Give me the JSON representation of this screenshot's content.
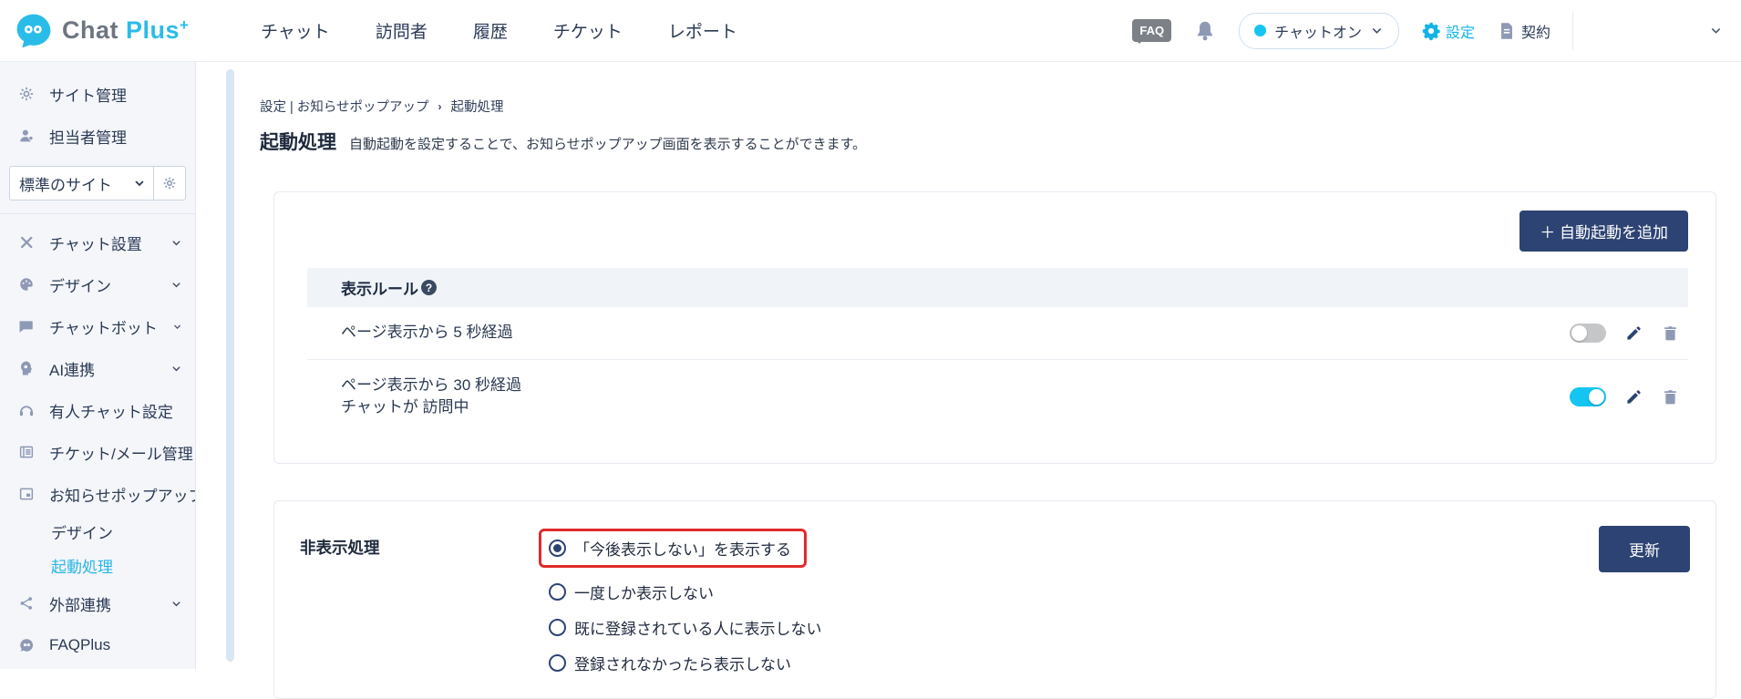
{
  "header": {
    "logo": {
      "word1": "Chat",
      "word2": "Plus",
      "sup": "+"
    },
    "nav": [
      {
        "label": "チャット"
      },
      {
        "label": "訪問者"
      },
      {
        "label": "履歴"
      },
      {
        "label": "チケット"
      },
      {
        "label": "レポート"
      }
    ],
    "faq_badge": "FAQ",
    "chat_status": {
      "label": "チャットオン",
      "state_color": "#16c4f0"
    },
    "settings_label": "設定",
    "contract_label": "契約"
  },
  "sidebar": {
    "top_items": [
      {
        "label": "サイト管理"
      },
      {
        "label": "担当者管理"
      }
    ],
    "site_select": {
      "value": "標準のサイト"
    },
    "menu": [
      {
        "label": "チャット設置",
        "chevron": true
      },
      {
        "label": "デザイン",
        "chevron": true
      },
      {
        "label": "チャットボット",
        "chevron": true
      },
      {
        "label": "AI連携",
        "chevron": true
      },
      {
        "label": "有人チャット設定",
        "chevron": true
      },
      {
        "label": "チケット/メール管理",
        "chevron": false
      },
      {
        "label": "お知らせポップアップ",
        "chevron": true,
        "expanded": true
      },
      {
        "label": "外部連携",
        "chevron": true
      },
      {
        "label": "FAQPlus",
        "chevron": false
      }
    ],
    "popup_children": [
      {
        "label": "デザイン",
        "active": false
      },
      {
        "label": "起動処理",
        "active": true
      }
    ]
  },
  "main": {
    "breadcrumb": {
      "parent": "設定 | お知らせポップアップ",
      "separator": "›",
      "current": "起動処理"
    },
    "title": "起動処理",
    "description": "自動起動を設定することで、お知らせポップアップ画面を表示することができます。",
    "rules_card": {
      "add_button": "＋ 自動起動を追加",
      "table_header": "表示ルール",
      "help_icon": "?",
      "rows": [
        {
          "lines": [
            "ページ表示から 5 秒経過"
          ],
          "enabled": false
        },
        {
          "lines": [
            "ページ表示から 30 秒経過",
            "チャットが 訪問中"
          ],
          "enabled": true
        }
      ]
    },
    "hide_card": {
      "label": "非表示処理",
      "options": [
        {
          "label": "「今後表示しない」を表示する",
          "selected": true,
          "highlighted": true
        },
        {
          "label": "一度しか表示しない",
          "selected": false,
          "highlighted": false
        },
        {
          "label": "既に登録されている人に表示しない",
          "selected": false,
          "highlighted": false
        },
        {
          "label": "登録されなかったら表示しない",
          "selected": false,
          "highlighted": false
        }
      ],
      "update_button": "更新"
    }
  },
  "colors": {
    "accent_cyan": "#29bce8",
    "toggle_on": "#13c5f0",
    "toggle_off": "#c4c6c8",
    "navy_button": "#2d4373",
    "highlight_red": "#e22b2b",
    "sidebar_bg": "#f4f6fa",
    "table_header_bg": "#f0f4f8"
  }
}
